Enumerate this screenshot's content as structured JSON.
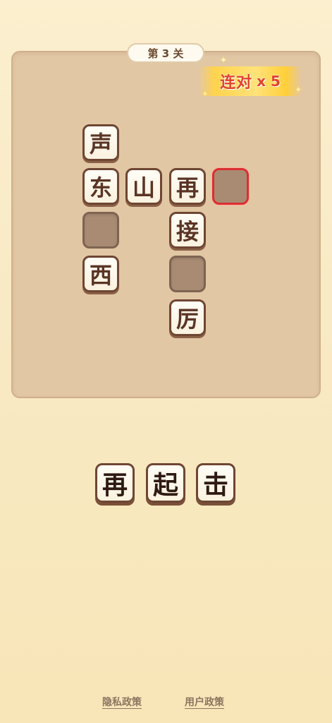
{
  "level": {
    "label": "第 3 关"
  },
  "combo": {
    "label": "连对",
    "count": "x 5",
    "color": "#e0432d"
  },
  "board": {
    "tiles": {
      "r0c0": "声",
      "r1c0": "东",
      "r1c1": "山",
      "r1c2": "再",
      "r2c2": "接",
      "r3c0": "西",
      "r4c2": "厉"
    },
    "empty_cells": [
      "r1c3",
      "r2c0",
      "r3c2"
    ],
    "selected_cell": "r1c3",
    "selected_color": "#d93030"
  },
  "options": [
    "再",
    "起",
    "击"
  ],
  "footer": {
    "privacy": "隐私政策",
    "terms": "用户政策"
  }
}
